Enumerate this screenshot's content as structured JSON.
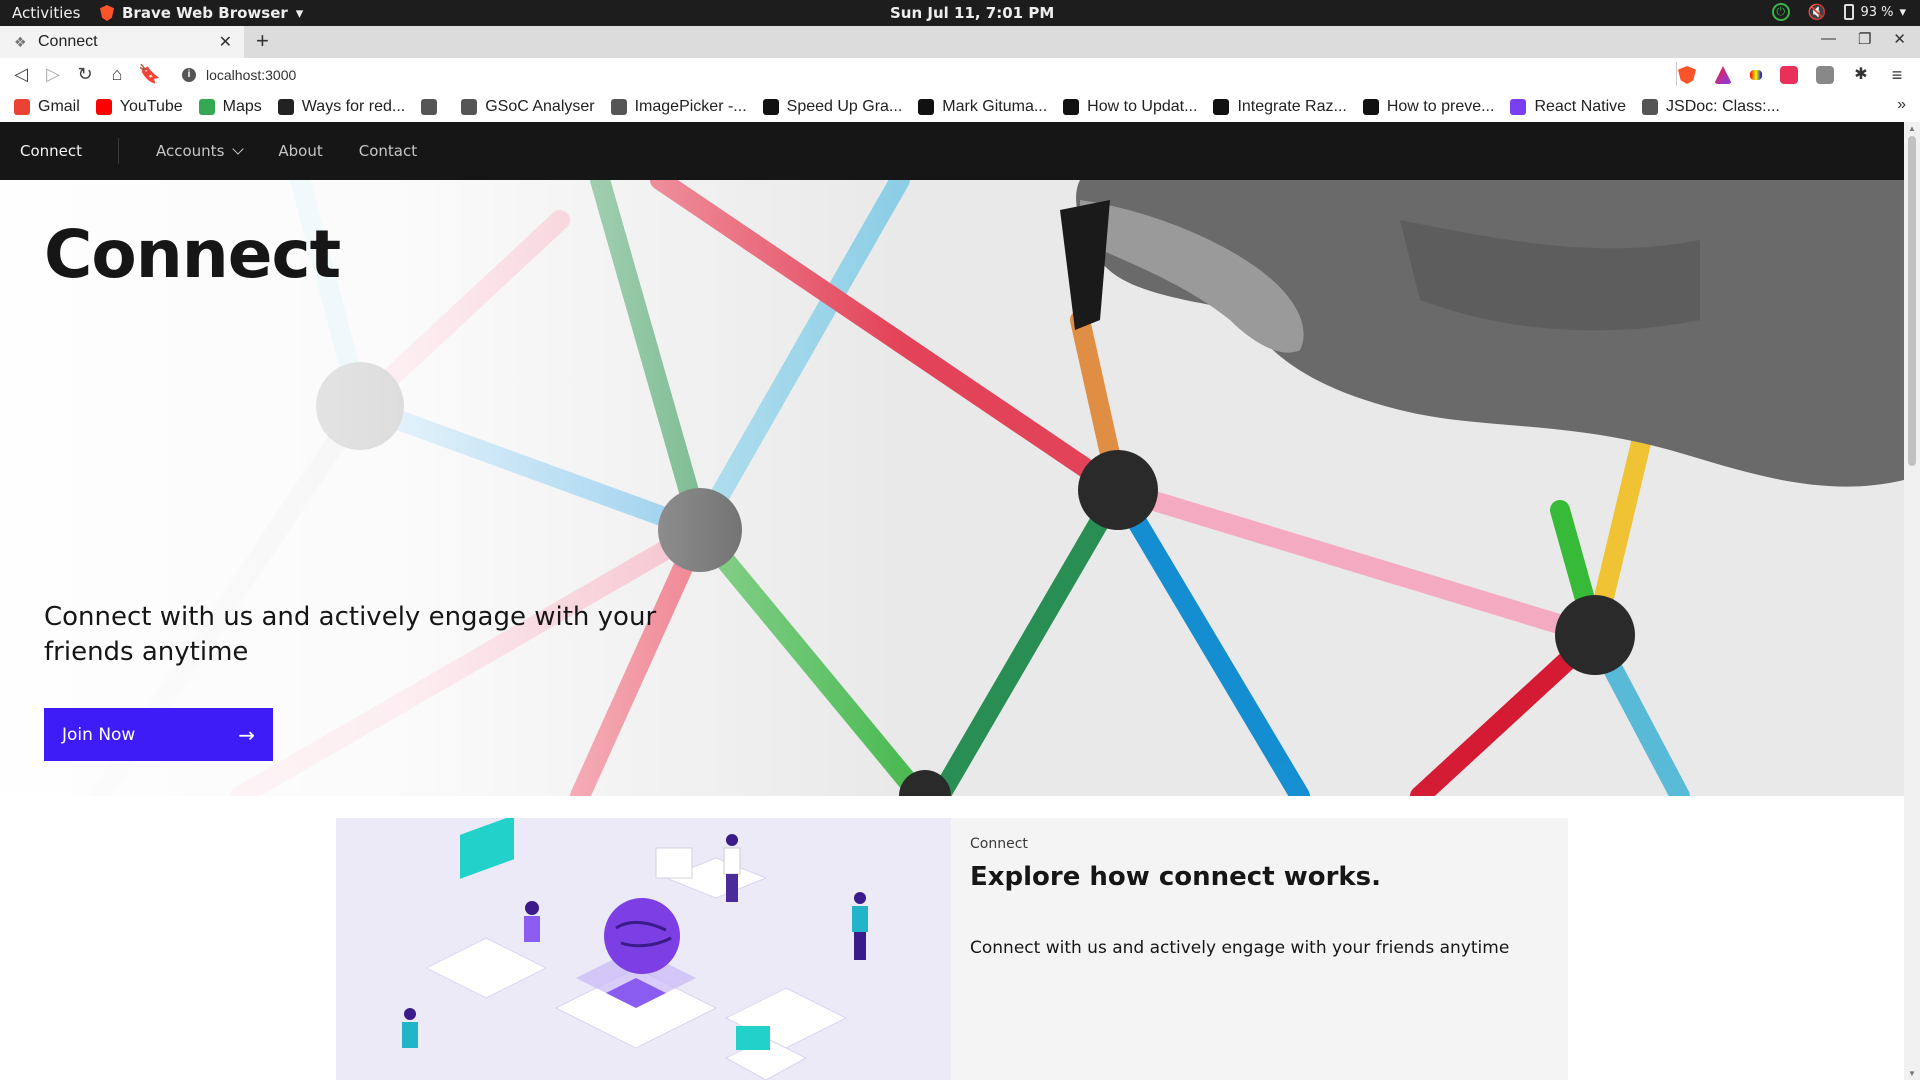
{
  "os": {
    "activities": "Activities",
    "app_name": "Brave Web Browser",
    "clock": "Sun Jul 11,  7:01 PM",
    "battery": "93 %"
  },
  "browser": {
    "tab_title": "Connect",
    "url": "localhost:3000",
    "bookmarks": [
      {
        "label": "Gmail",
        "icon": "gmail-icon",
        "color": "#ea4335"
      },
      {
        "label": "YouTube",
        "icon": "youtube-icon",
        "color": "#ff0000"
      },
      {
        "label": "Maps",
        "icon": "maps-icon",
        "color": "#34a853"
      },
      {
        "label": "Ways for red...",
        "icon": "site-icon",
        "color": "#222222"
      },
      {
        "label": "",
        "icon": "globe-icon",
        "color": "#555555"
      },
      {
        "label": "GSoC Analyser",
        "icon": "chart-icon",
        "color": "#555555"
      },
      {
        "label": "ImagePicker -...",
        "icon": "site-icon",
        "color": "#555555"
      },
      {
        "label": "Speed Up Gra...",
        "icon": "medium-icon",
        "color": "#111111"
      },
      {
        "label": "Mark Gituma...",
        "icon": "medium-icon",
        "color": "#111111"
      },
      {
        "label": "How to Updat...",
        "icon": "dev-icon",
        "color": "#111111"
      },
      {
        "label": "Integrate Raz...",
        "icon": "dev-icon",
        "color": "#111111"
      },
      {
        "label": "How to preve...",
        "icon": "site-icon",
        "color": "#111111"
      },
      {
        "label": "React Native",
        "icon": "dots-icon",
        "color": "#7b3ff2"
      },
      {
        "label": "JSDoc: Class:...",
        "icon": "globe-icon",
        "color": "#555555"
      }
    ]
  },
  "site": {
    "brand": "Connect",
    "nav": {
      "accounts": "Accounts",
      "about": "About",
      "contact": "Contact"
    },
    "hero": {
      "title": "Connect",
      "subtitle": "Connect with us and actively engage with your friends anytime",
      "cta": "Join Now",
      "cta_color": "#3d1cf8"
    },
    "explore": {
      "eyebrow": "Connect",
      "title": "Explore how connect works.",
      "body": "Connect with us and actively engage with your friends anytime"
    }
  }
}
